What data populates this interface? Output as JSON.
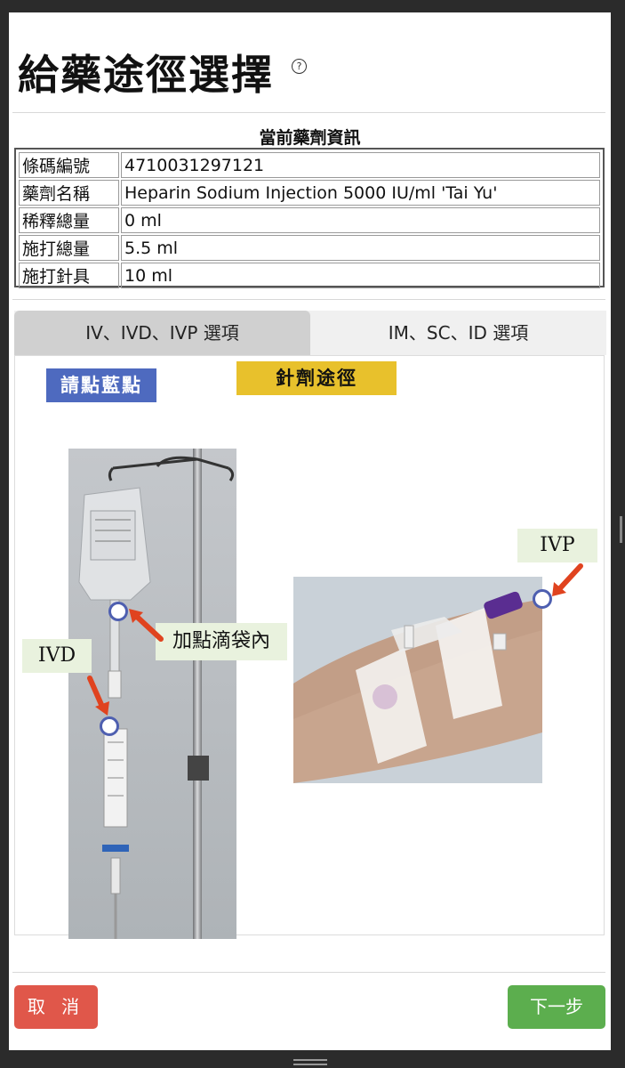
{
  "header": {
    "title": "給藥途徑選擇",
    "help_icon": "question-circle-icon",
    "help_glyph": "?"
  },
  "drug_info": {
    "caption": "當前藥劑資訊",
    "rows": [
      {
        "key": "條碼編號",
        "value": "4710031297121"
      },
      {
        "key": "藥劑名稱",
        "value": "Heparin Sodium Injection 5000 IU/ml 'Tai Yu'"
      },
      {
        "key": "稀釋總量",
        "value": "0 ml"
      },
      {
        "key": "施打總量",
        "value": "5.5 ml"
      },
      {
        "key": "施打針具",
        "value": "10 ml"
      }
    ]
  },
  "tabs": [
    {
      "label": "IV、IVD、IVP 選項",
      "active": true
    },
    {
      "label": "IM、SC、ID 選項",
      "active": false
    }
  ],
  "panel": {
    "hint": "請點藍點",
    "section_header": "針劑途徑",
    "labels": {
      "bag": "加點滴袋內",
      "ivd": "IVD",
      "ivp": "IVP"
    }
  },
  "footer": {
    "cancel": "取 消",
    "next": "下一步"
  },
  "colors": {
    "hint_bg": "#4e6abf",
    "header_bg": "#e8c12c",
    "label_bg": "#e9f2de",
    "dot_ring": "#4e5fb0",
    "arrow": "#e0431f",
    "cancel_bg": "#e0574a",
    "next_bg": "#5cae4e"
  }
}
